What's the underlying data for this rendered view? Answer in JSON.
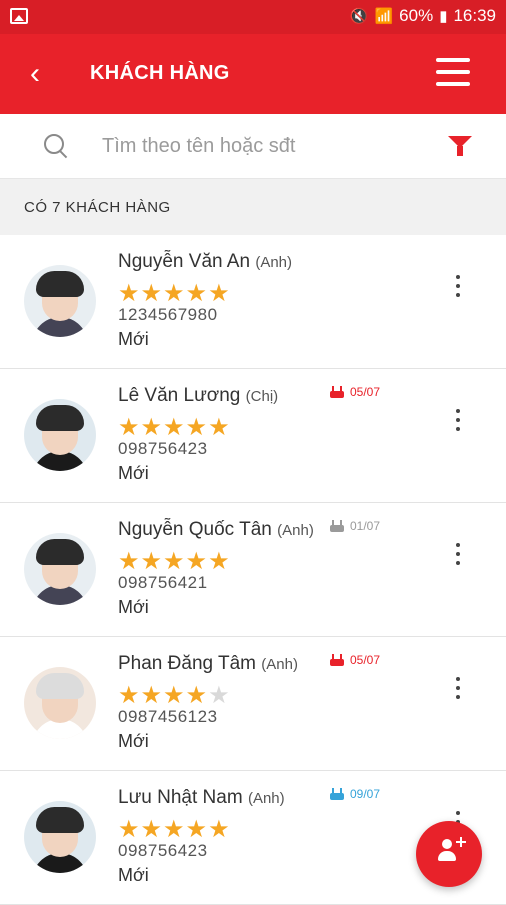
{
  "status_bar": {
    "battery": "60%",
    "time": "16:39"
  },
  "app_bar": {
    "title": "KHÁCH HÀNG"
  },
  "search": {
    "placeholder": "Tìm theo tên hoặc sđt"
  },
  "count_label": "CÓ 7 KHÁCH HÀNG",
  "customers": [
    {
      "name": "Nguyễn Văn An",
      "relation": "(Anh)",
      "phone": "1234567980",
      "status": "Mới",
      "rating": 5,
      "birthday": "",
      "birthday_color": ""
    },
    {
      "name": "Lê Văn Lương",
      "relation": "(Chị)",
      "phone": "098756423",
      "status": "Mới",
      "rating": 5,
      "birthday": "05/07",
      "birthday_color": "#e8222a"
    },
    {
      "name": "Nguyễn Quốc Tân",
      "relation": "(Anh)",
      "phone": "098756421",
      "status": "Mới",
      "rating": 5,
      "birthday": "01/07",
      "birthday_color": "#9a9a9a"
    },
    {
      "name": "Phan Đăng Tâm",
      "relation": "(Anh)",
      "phone": "0987456123",
      "status": "Mới",
      "rating": 4,
      "birthday": "05/07",
      "birthday_color": "#e8222a"
    },
    {
      "name": "Lưu Nhật Nam",
      "relation": "(Anh)",
      "phone": "098756423",
      "status": "Mới",
      "rating": 5,
      "birthday": "09/07",
      "birthday_color": "#36a3d9"
    }
  ],
  "colors": {
    "primary": "#e8222a",
    "star": "#f5a623"
  }
}
